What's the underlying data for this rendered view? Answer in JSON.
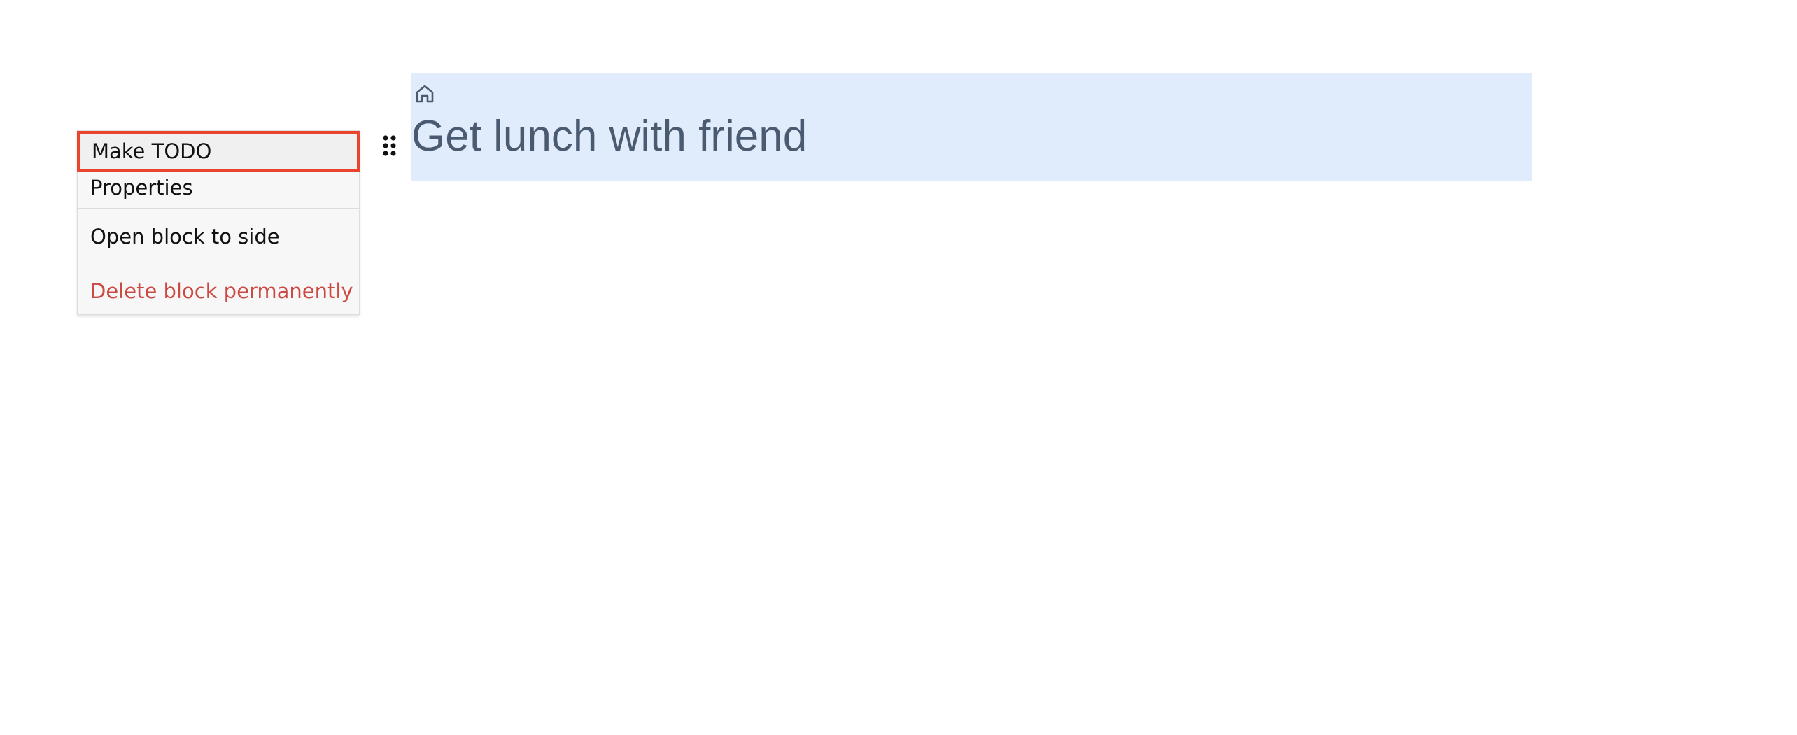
{
  "context_menu": {
    "items": [
      {
        "label": "Make TODO"
      },
      {
        "label": "Properties"
      },
      {
        "label": "Open block to side"
      },
      {
        "label": "Delete block permanently"
      }
    ]
  },
  "block": {
    "icon": "home-icon",
    "title": "Get lunch with friend"
  },
  "drag_handle": {
    "icon": "drag-handle-icon"
  },
  "colors": {
    "highlight_border": "#e8452c",
    "delete_text": "#cc4a44",
    "block_background": "#e0ecfc",
    "title_text": "#4a5a70"
  }
}
